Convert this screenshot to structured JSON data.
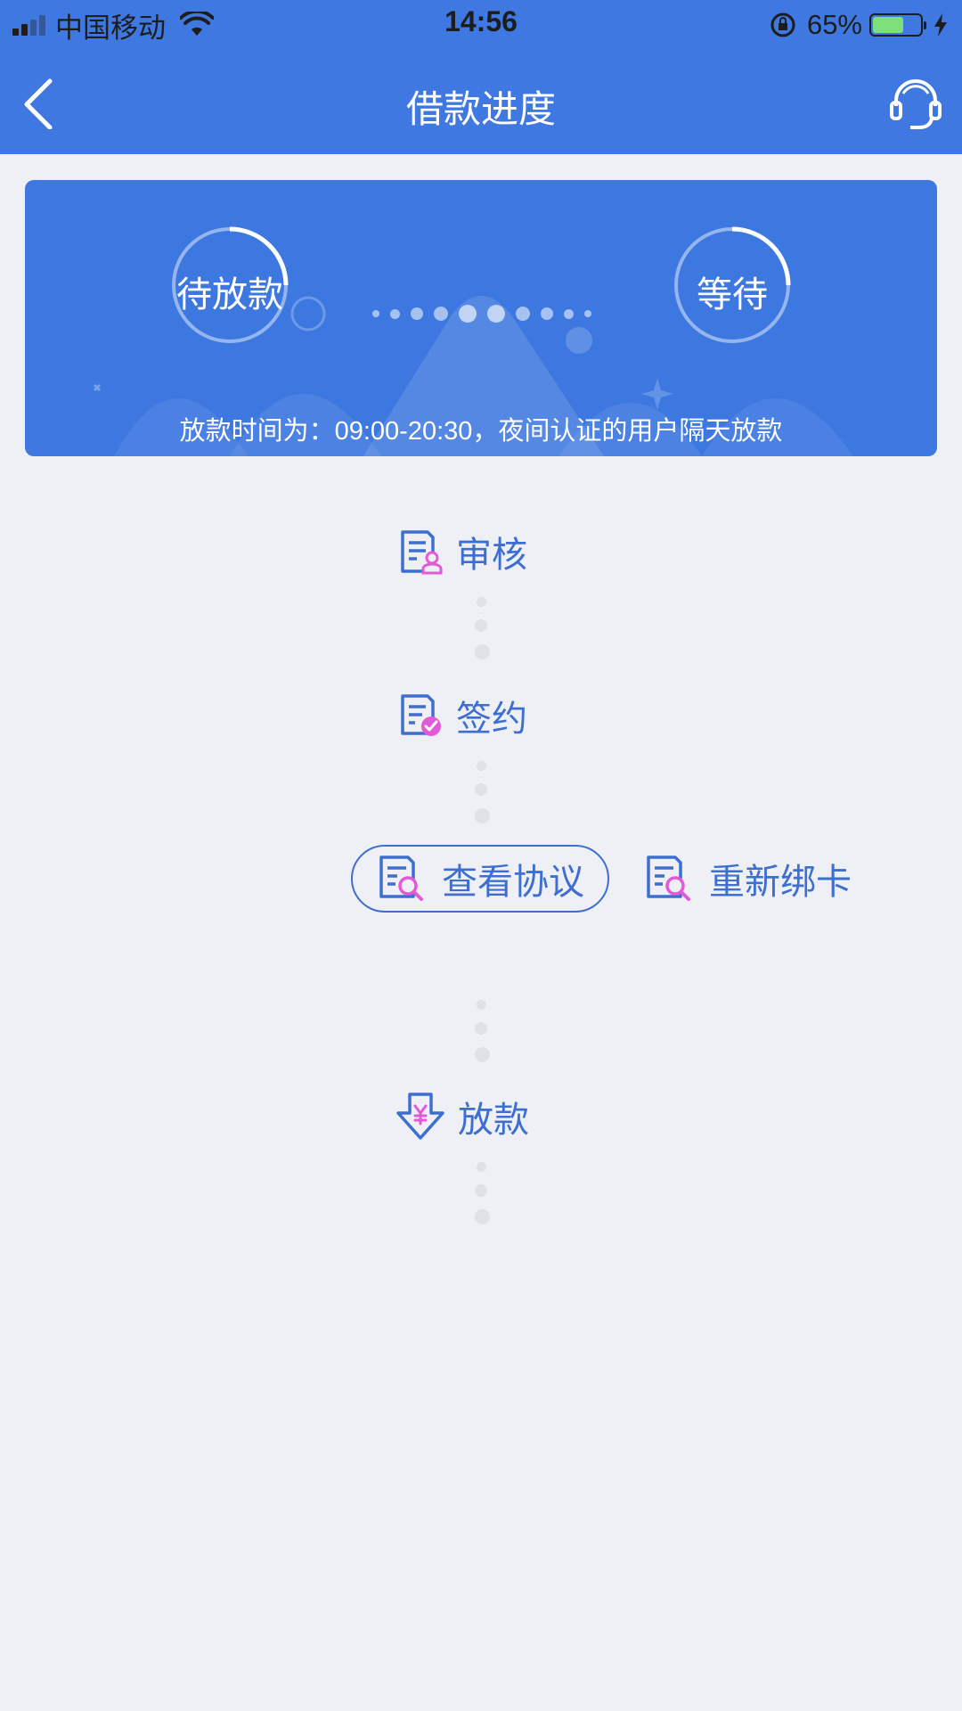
{
  "status_bar": {
    "carrier": "中国移动",
    "time": "14:56",
    "battery_percent": "65%",
    "battery_level": 0.65,
    "icons": [
      "signal-icon",
      "wifi-icon",
      "rotation-lock-icon",
      "battery-icon",
      "charging-icon"
    ]
  },
  "header": {
    "title": "借款进度",
    "back_icon": "back-chevron-icon",
    "service_icon": "headset-icon"
  },
  "banner": {
    "left_status": "待放款",
    "right_status": "等待",
    "note": "放款时间为：09:00-20:30，夜间认证的用户隔天放款"
  },
  "steps": [
    {
      "label": "审核",
      "icon": "review-document-icon"
    },
    {
      "label": "签约",
      "icon": "signed-document-icon"
    },
    {
      "label": "放款",
      "icon": "disbursement-arrow-icon"
    }
  ],
  "actions": {
    "view_agreement": "查看协议",
    "rebind_card": "重新绑卡",
    "action_icon": "document-search-icon"
  },
  "colors": {
    "primary": "#3f78e0",
    "accent_pink": "#e25ad8",
    "step_text": "#3d6fd0",
    "background": "#eff0f5"
  }
}
